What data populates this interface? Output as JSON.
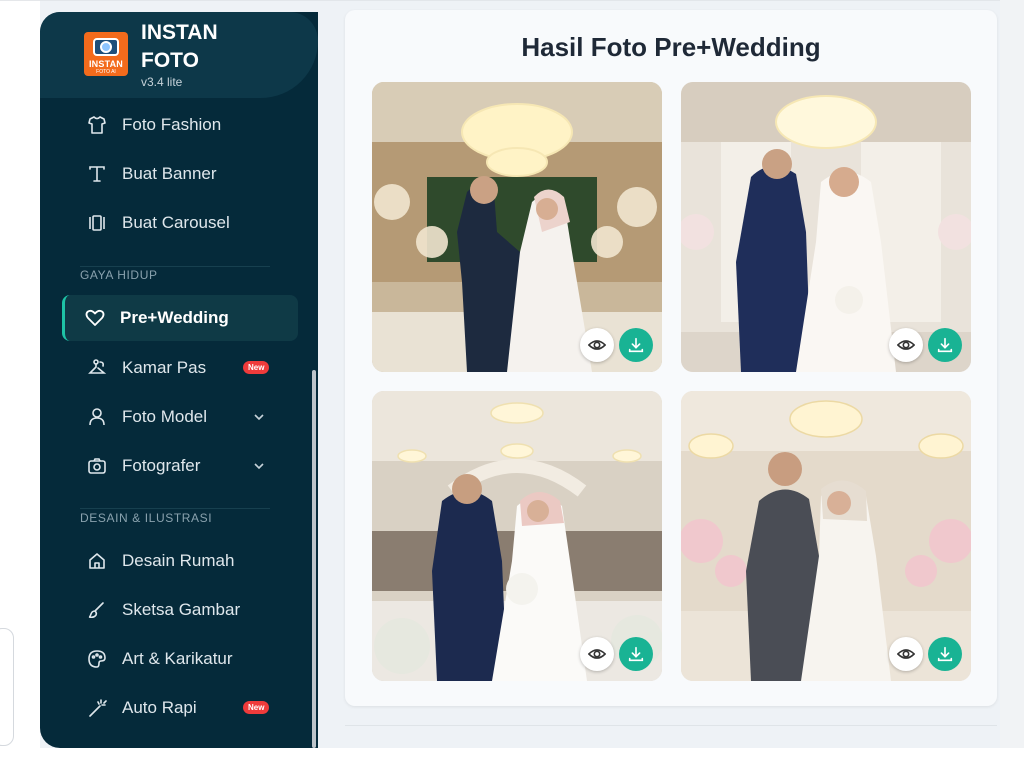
{
  "brand": {
    "name_line1": "INSTAN",
    "name_line2": "FOTO",
    "version": "v3.4 lite",
    "logo_text1": "INSTAN",
    "logo_text2": "FOTO AI"
  },
  "sidebar": {
    "items_top": [
      {
        "label": "Foto Fashion",
        "icon": "shirt-icon"
      },
      {
        "label": "Buat Banner",
        "icon": "text-icon"
      },
      {
        "label": "Buat Carousel",
        "icon": "carousel-icon"
      }
    ],
    "section_gaya": "GAYA HIDUP",
    "items_gaya": [
      {
        "label": "Pre+Wedding",
        "icon": "heart-icon",
        "active": true
      },
      {
        "label": "Kamar Pas",
        "icon": "hanger-icon",
        "badge": "New"
      },
      {
        "label": "Foto Model",
        "icon": "person-icon"
      },
      {
        "label": "Fotografer",
        "icon": "camera-icon"
      }
    ],
    "section_desain": "DESAIN & ILUSTRASI",
    "items_desain": [
      {
        "label": "Desain Rumah",
        "icon": "home-icon"
      },
      {
        "label": "Sketsa Gambar",
        "icon": "brush-icon"
      },
      {
        "label": "Art & Karikatur",
        "icon": "palette-icon"
      },
      {
        "label": "Auto Rapi",
        "icon": "wand-icon",
        "badge": "New"
      }
    ]
  },
  "main": {
    "title": "Hasil Foto Pre+Wedding",
    "photos": [
      {
        "name": "photo-1"
      },
      {
        "name": "photo-2"
      },
      {
        "name": "photo-3"
      },
      {
        "name": "photo-4"
      }
    ]
  },
  "colors": {
    "sidebar_bg": "#052a3a",
    "accent": "#1ec3a6",
    "download_btn": "#19b394",
    "badge": "#ef3b3b"
  }
}
